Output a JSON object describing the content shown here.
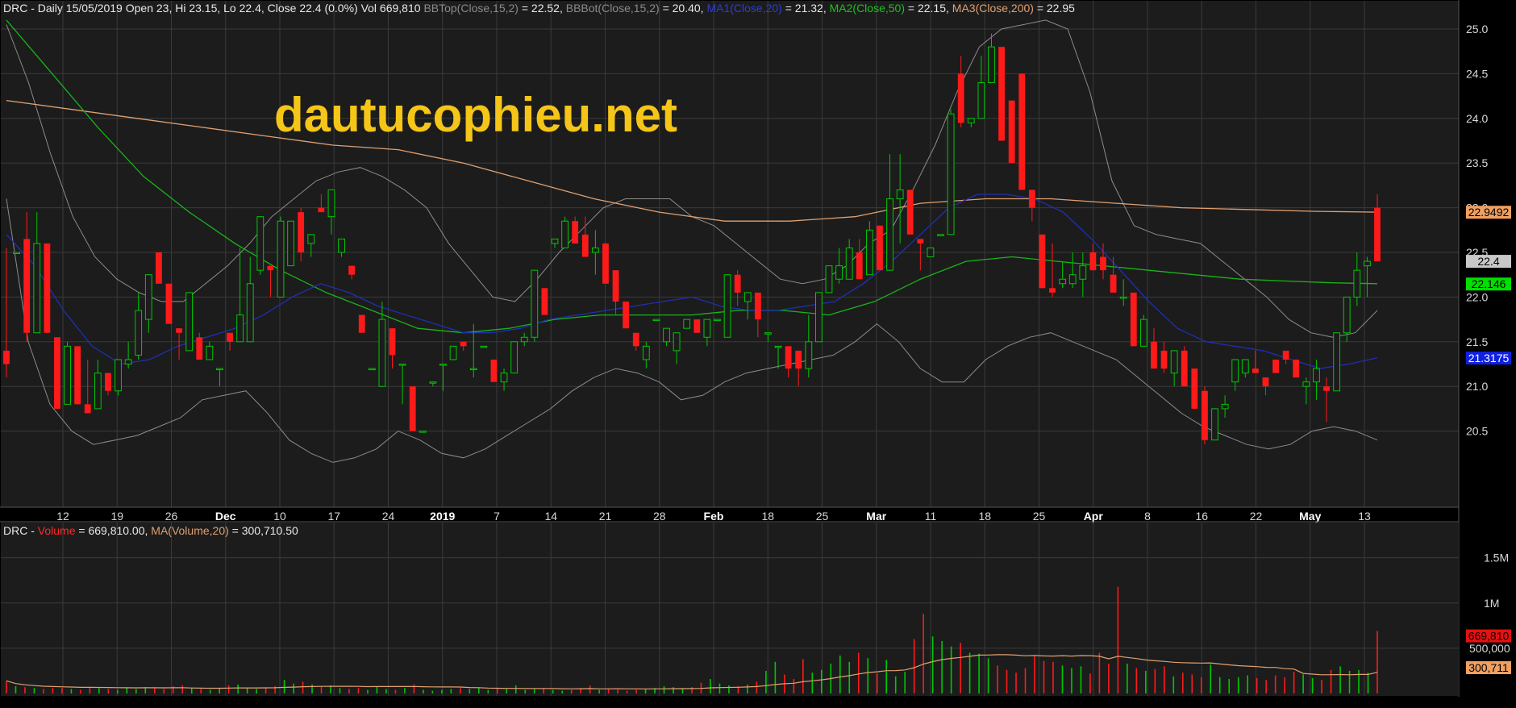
{
  "watermark": "dautucophieu.net",
  "price_header": {
    "prefix": "DRC - Daily 15/05/2019 Open 23, Hi 23.15, Lo 22.4, Close 22.4 (0.0%) Vol 669,810 ",
    "bbtop_label": "BBTop(Close,15,2)",
    "bbtop_value": " = 22.52, ",
    "bbbot_label": "BBBot(Close,15,2)",
    "bbbot_value": " = 20.40, ",
    "ma1_label": "MA1(Close,20)",
    "ma1_value": " = 21.32, ",
    "ma2_label": "MA2(Close,50)",
    "ma2_value": " = 22.15, ",
    "ma3_label": "MA3(Close,200)",
    "ma3_value": " = 22.95"
  },
  "volume_header": {
    "prefix": "DRC - ",
    "vol_label": "Volume",
    "vol_value": " = 669,810.00, ",
    "mavol_label": "MA(Volume,20)",
    "mavol_value": " = 300,710.50"
  },
  "colors": {
    "up": "#00c800",
    "down": "#ff1a1a",
    "background": "#1c1c1c",
    "grid": "#3a3a3a",
    "bb": "#8c8c8c",
    "ma1": "#1f2fb5",
    "ma2": "#19b419",
    "ma3": "#e0a070",
    "text": "#d8d8d8",
    "watermark": "#f5c518"
  },
  "chart_data": [
    {
      "type": "candlestick",
      "ylim": [
        20.2,
        25.2
      ],
      "yticks": [
        "25.0",
        "24.5",
        "24.0",
        "23.5",
        "23.0",
        "22.5",
        "22.0",
        "21.5",
        "21.0",
        "20.5"
      ],
      "xtick_labels": [
        "12",
        "19",
        "26",
        "Dec",
        "10",
        "17",
        "24",
        "2019",
        "7",
        "14",
        "21",
        "28",
        "Feb",
        "18",
        "25",
        "Mar",
        "11",
        "18",
        "25",
        "Apr",
        "8",
        "16",
        "22",
        "May",
        "13"
      ],
      "bold_labels": [
        "Dec",
        "2019",
        "Feb",
        "Mar",
        "Apr",
        "May"
      ],
      "candles": [
        [
          21.4,
          22.55,
          21.1,
          21.25
        ],
        [
          22.5,
          22.5,
          22.5,
          22.5
        ],
        [
          22.65,
          22.95,
          21.5,
          21.6
        ],
        [
          21.6,
          22.95,
          21.6,
          22.6
        ],
        [
          22.6,
          22.6,
          21.6,
          21.6
        ],
        [
          21.55,
          21.55,
          20.75,
          20.75
        ],
        [
          20.8,
          21.5,
          20.8,
          21.45
        ],
        [
          21.45,
          21.45,
          20.8,
          20.8
        ],
        [
          20.8,
          21.3,
          20.7,
          20.7
        ],
        [
          20.75,
          21.3,
          20.75,
          21.15
        ],
        [
          21.15,
          21.15,
          20.9,
          20.95
        ],
        [
          20.95,
          21.3,
          20.9,
          21.3
        ],
        [
          21.25,
          21.5,
          21.2,
          21.3
        ],
        [
          21.35,
          22.05,
          21.3,
          21.85
        ],
        [
          21.75,
          22.25,
          21.6,
          22.25
        ],
        [
          22.5,
          22.5,
          22.15,
          22.15
        ],
        [
          22.15,
          22.15,
          21.7,
          21.7
        ],
        [
          21.65,
          21.65,
          21.3,
          21.6
        ],
        [
          21.4,
          22.05,
          21.4,
          22.05
        ],
        [
          21.55,
          21.6,
          21.3,
          21.3
        ],
        [
          21.3,
          21.5,
          21.3,
          21.45
        ],
        [
          21.2,
          21.2,
          21.0,
          21.2
        ],
        [
          21.6,
          21.6,
          21.4,
          21.5
        ],
        [
          21.5,
          22.55,
          21.5,
          21.8
        ],
        [
          21.5,
          22.45,
          21.6,
          22.15
        ],
        [
          22.3,
          22.9,
          22.25,
          22.9
        ],
        [
          22.35,
          22.35,
          22.0,
          22.3
        ],
        [
          22.0,
          22.9,
          22.0,
          22.85
        ],
        [
          22.35,
          22.85,
          22.35,
          22.85
        ],
        [
          22.95,
          23.0,
          22.4,
          22.5
        ],
        [
          22.6,
          22.6,
          22.45,
          22.7
        ],
        [
          23.0,
          23.15,
          23.0,
          22.95
        ],
        [
          22.9,
          23.2,
          22.7,
          23.2
        ],
        [
          22.5,
          22.5,
          22.45,
          22.65
        ],
        [
          22.35,
          22.35,
          22.2,
          22.25
        ],
        [
          21.8,
          21.8,
          21.6,
          21.6
        ],
        [
          21.2,
          21.2,
          21.2,
          21.2
        ],
        [
          21.0,
          21.95,
          21.0,
          21.75
        ],
        [
          21.65,
          21.65,
          21.2,
          21.35
        ],
        [
          21.25,
          21.25,
          20.8,
          21.25
        ],
        [
          21.0,
          21.0,
          20.5,
          20.5
        ],
        [
          20.5,
          20.5,
          20.5,
          20.5
        ],
        [
          21.05,
          21.05,
          21.0,
          21.05
        ],
        [
          21.25,
          21.25,
          20.95,
          21.25
        ],
        [
          21.3,
          21.3,
          21.35,
          21.45
        ],
        [
          21.5,
          21.5,
          21.4,
          21.45
        ],
        [
          21.2,
          21.7,
          21.1,
          21.2
        ],
        [
          21.45,
          21.45,
          21.45,
          21.45
        ],
        [
          21.3,
          21.3,
          21.05,
          21.05
        ],
        [
          21.05,
          21.2,
          20.95,
          21.15
        ],
        [
          21.15,
          21.5,
          21.15,
          21.5
        ],
        [
          21.5,
          21.6,
          21.45,
          21.55
        ],
        [
          21.55,
          22.3,
          21.5,
          22.3
        ],
        [
          22.1,
          22.1,
          21.8,
          21.8
        ],
        [
          22.6,
          22.6,
          22.55,
          22.65
        ],
        [
          22.55,
          22.9,
          22.55,
          22.85
        ],
        [
          22.85,
          22.9,
          22.6,
          22.6
        ],
        [
          22.7,
          22.9,
          22.45,
          22.45
        ],
        [
          22.5,
          22.75,
          22.25,
          22.55
        ],
        [
          22.6,
          22.6,
          22.15,
          22.15
        ],
        [
          22.3,
          22.3,
          21.8,
          21.95
        ],
        [
          21.95,
          21.95,
          21.65,
          21.65
        ],
        [
          21.6,
          21.6,
          21.4,
          21.45
        ],
        [
          21.3,
          21.5,
          21.2,
          21.45
        ],
        [
          21.75,
          21.75,
          21.75,
          21.75
        ],
        [
          21.5,
          21.5,
          21.45,
          21.65
        ],
        [
          21.4,
          21.4,
          21.25,
          21.6
        ],
        [
          21.65,
          21.65,
          21.65,
          21.75
        ],
        [
          21.75,
          21.75,
          21.6,
          21.6
        ],
        [
          21.55,
          21.55,
          21.45,
          21.75
        ],
        [
          21.75,
          21.75,
          21.75,
          21.75
        ],
        [
          21.55,
          22.05,
          21.55,
          22.25
        ],
        [
          22.25,
          22.3,
          21.9,
          22.05
        ],
        [
          21.95,
          21.95,
          21.75,
          22.05
        ],
        [
          22.05,
          22.05,
          21.55,
          21.75
        ],
        [
          21.6,
          21.6,
          21.5,
          21.6
        ],
        [
          21.45,
          21.45,
          21.2,
          21.45
        ],
        [
          21.45,
          21.45,
          21.1,
          21.2
        ],
        [
          21.4,
          21.4,
          21.0,
          21.2
        ],
        [
          21.2,
          21.8,
          21.1,
          21.5
        ],
        [
          21.5,
          21.75,
          21.5,
          22.05
        ],
        [
          22.05,
          22.3,
          22.05,
          22.35
        ],
        [
          22.2,
          22.55,
          22.15,
          22.35
        ],
        [
          22.2,
          22.65,
          22.2,
          22.55
        ],
        [
          22.5,
          22.65,
          22.2,
          22.2
        ],
        [
          22.25,
          22.85,
          22.25,
          22.75
        ],
        [
          22.8,
          22.8,
          22.3,
          22.3
        ],
        [
          22.3,
          23.6,
          22.3,
          23.1
        ],
        [
          23.1,
          23.6,
          22.6,
          23.2
        ],
        [
          23.2,
          23.2,
          22.7,
          22.7
        ],
        [
          22.65,
          22.65,
          22.3,
          22.6
        ],
        [
          22.45,
          22.45,
          22.45,
          22.55
        ],
        [
          22.7,
          22.7,
          22.7,
          22.7
        ],
        [
          22.7,
          24.1,
          22.7,
          24.05
        ],
        [
          24.5,
          24.7,
          23.9,
          23.95
        ],
        [
          23.95,
          23.95,
          23.9,
          24.0
        ],
        [
          24.0,
          24.7,
          24.0,
          24.4
        ],
        [
          24.4,
          24.95,
          24.4,
          24.8
        ],
        [
          24.8,
          24.8,
          23.85,
          23.75
        ],
        [
          24.2,
          24.2,
          23.5,
          23.5
        ],
        [
          24.5,
          24.5,
          23.25,
          23.2
        ],
        [
          23.2,
          23.2,
          22.85,
          23.0
        ],
        [
          22.7,
          22.7,
          22.1,
          22.1
        ],
        [
          22.1,
          22.6,
          22.0,
          22.05
        ],
        [
          22.15,
          22.4,
          22.1,
          22.2
        ],
        [
          22.15,
          22.5,
          22.1,
          22.25
        ],
        [
          22.2,
          22.5,
          22.0,
          22.35
        ],
        [
          22.5,
          22.6,
          22.3,
          22.3
        ],
        [
          22.45,
          22.6,
          22.2,
          22.3
        ],
        [
          22.25,
          22.45,
          22.1,
          22.05
        ],
        [
          22.0,
          22.2,
          21.9,
          22.0
        ],
        [
          22.05,
          22.05,
          21.45,
          21.45
        ],
        [
          21.45,
          21.8,
          21.45,
          21.75
        ],
        [
          21.5,
          21.65,
          21.2,
          21.2
        ],
        [
          21.4,
          21.5,
          21.15,
          21.2
        ],
        [
          21.15,
          21.4,
          21.0,
          21.4
        ],
        [
          21.4,
          21.45,
          21.05,
          21.0
        ],
        [
          21.2,
          21.2,
          20.8,
          20.75
        ],
        [
          20.95,
          21.0,
          20.35,
          20.4
        ],
        [
          20.4,
          20.7,
          20.4,
          20.75
        ],
        [
          20.75,
          20.9,
          20.65,
          20.8
        ],
        [
          21.05,
          21.3,
          20.95,
          21.3
        ],
        [
          21.15,
          21.3,
          21.1,
          21.3
        ],
        [
          21.2,
          21.4,
          21.15,
          21.15
        ],
        [
          21.1,
          21.1,
          20.9,
          21.0
        ],
        [
          21.3,
          21.3,
          21.15,
          21.15
        ],
        [
          21.4,
          21.4,
          21.25,
          21.3
        ],
        [
          21.3,
          21.3,
          21.1,
          21.1
        ],
        [
          21.0,
          21.1,
          20.8,
          21.05
        ],
        [
          21.05,
          21.3,
          20.85,
          21.2
        ],
        [
          21.0,
          21.1,
          20.6,
          20.95
        ],
        [
          20.95,
          21.6,
          20.95,
          21.6
        ],
        [
          21.6,
          22.0,
          21.5,
          22.0
        ],
        [
          22.0,
          22.5,
          21.9,
          22.3
        ],
        [
          22.35,
          22.45,
          22.0,
          22.4
        ],
        [
          23.0,
          23.15,
          22.4,
          22.4
        ]
      ],
      "bb_top": [
        25.05,
        24.4,
        23.6,
        22.9,
        22.45,
        22.2,
        22.05,
        21.95,
        21.95,
        22.15,
        22.35,
        22.6,
        22.9,
        23.1,
        23.3,
        23.4,
        23.45,
        23.35,
        23.2,
        23.0,
        22.6,
        22.3,
        22.0,
        21.95,
        22.2,
        22.5,
        22.75,
        23.0,
        23.1,
        23.1,
        23.1,
        22.9,
        22.8,
        22.6,
        22.4,
        22.2,
        22.15,
        22.2,
        22.35,
        22.6,
        22.75,
        23.2,
        23.7,
        24.3,
        24.8,
        25.0,
        25.05,
        25.1,
        25.0,
        24.3,
        23.3,
        22.8,
        22.7,
        22.65,
        22.6,
        22.4,
        22.2,
        22.0,
        21.75,
        21.6,
        21.55,
        21.6,
        21.85
      ],
      "bb_bot": [
        23.1,
        21.5,
        20.8,
        20.5,
        20.35,
        20.4,
        20.45,
        20.55,
        20.65,
        20.85,
        20.9,
        20.95,
        20.7,
        20.4,
        20.25,
        20.15,
        20.2,
        20.3,
        20.5,
        20.4,
        20.25,
        20.2,
        20.3,
        20.45,
        20.6,
        20.75,
        20.95,
        21.1,
        21.2,
        21.15,
        21.05,
        20.85,
        20.9,
        21.05,
        21.15,
        21.2,
        21.25,
        21.3,
        21.35,
        21.5,
        21.7,
        21.5,
        21.2,
        21.05,
        21.05,
        21.3,
        21.45,
        21.55,
        21.6,
        21.5,
        21.4,
        21.3,
        21.1,
        20.9,
        20.7,
        20.55,
        20.45,
        20.35,
        20.3,
        20.35,
        20.5,
        20.55,
        20.5,
        20.4
      ],
      "ma1": [
        22.7,
        22.35,
        21.85,
        21.45,
        21.25,
        21.3,
        21.45,
        21.55,
        21.65,
        21.8,
        22.0,
        22.15,
        22.05,
        21.9,
        21.8,
        21.7,
        21.6,
        21.6,
        21.65,
        21.75,
        21.8,
        21.85,
        21.9,
        21.95,
        22.0,
        21.9,
        21.85,
        21.85,
        21.9,
        21.95,
        22.15,
        22.4,
        22.7,
        23.0,
        23.15,
        23.15,
        23.1,
        22.95,
        22.65,
        22.3,
        21.95,
        21.65,
        21.5,
        21.45,
        21.4,
        21.3,
        21.2,
        21.25,
        21.32
      ],
      "ma2": [
        25.1,
        24.5,
        23.9,
        23.35,
        22.95,
        22.6,
        22.3,
        22.05,
        21.85,
        21.65,
        21.6,
        21.65,
        21.75,
        21.8,
        21.8,
        21.8,
        21.85,
        21.85,
        21.8,
        21.95,
        22.2,
        22.4,
        22.45,
        22.4,
        22.35,
        22.3,
        22.25,
        22.2,
        22.18,
        22.16,
        22.15
      ],
      "ma3": [
        24.2,
        24.1,
        24.0,
        23.9,
        23.8,
        23.7,
        23.65,
        23.5,
        23.3,
        23.1,
        22.95,
        22.85,
        22.85,
        22.9,
        23.05,
        23.1,
        23.1,
        23.05,
        23.0,
        22.98,
        22.96,
        22.95
      ],
      "last_value_tags": [
        "22.9492",
        "22.4",
        "22.146",
        "21.3175"
      ]
    },
    {
      "type": "bar",
      "title": "Volume",
      "yticks": [
        "1.5M",
        "1M",
        "500,000"
      ],
      "ylim": [
        0,
        1800000
      ],
      "values": [
        140000,
        80000,
        70000,
        60000,
        50000,
        60000,
        60000,
        50000,
        40000,
        70000,
        60000,
        50000,
        40000,
        60000,
        50000,
        70000,
        60000,
        50000,
        80000,
        90000,
        60000,
        50000,
        40000,
        60000,
        90000,
        100000,
        60000,
        50000,
        60000,
        80000,
        150000,
        110000,
        130000,
        100000,
        80000,
        90000,
        60000,
        50000,
        60000,
        40000,
        80000,
        50000,
        40000,
        60000,
        100000,
        40000,
        30000,
        40000,
        50000,
        60000,
        50000,
        70000,
        40000,
        60000,
        50000,
        90000,
        40000,
        50000,
        60000,
        40000,
        30000,
        40000,
        60000,
        90000,
        40000,
        50000,
        40000,
        30000,
        40000,
        50000,
        60000,
        80000,
        70000,
        60000,
        70000,
        120000,
        160000,
        110000,
        90000,
        80000,
        100000,
        130000,
        250000,
        350000,
        210000,
        160000,
        380000,
        230000,
        260000,
        330000,
        420000,
        350000,
        450000,
        390000,
        220000,
        370000,
        190000,
        240000,
        600000,
        880000,
        630000,
        580000,
        520000,
        560000,
        450000,
        440000,
        390000,
        310000,
        260000,
        230000,
        280000,
        410000,
        360000,
        350000,
        310000,
        280000,
        300000,
        220000,
        450000,
        330000,
        1180000,
        330000,
        280000,
        250000,
        270000,
        300000,
        190000,
        230000,
        210000,
        180000,
        320000,
        180000,
        160000,
        180000,
        200000,
        170000,
        150000,
        200000,
        180000,
        240000,
        210000,
        170000,
        150000,
        260000,
        300000,
        250000,
        260000,
        230000,
        690000
      ],
      "ma_vol_value": "300,711",
      "last_vol_value": "669,810"
    }
  ]
}
